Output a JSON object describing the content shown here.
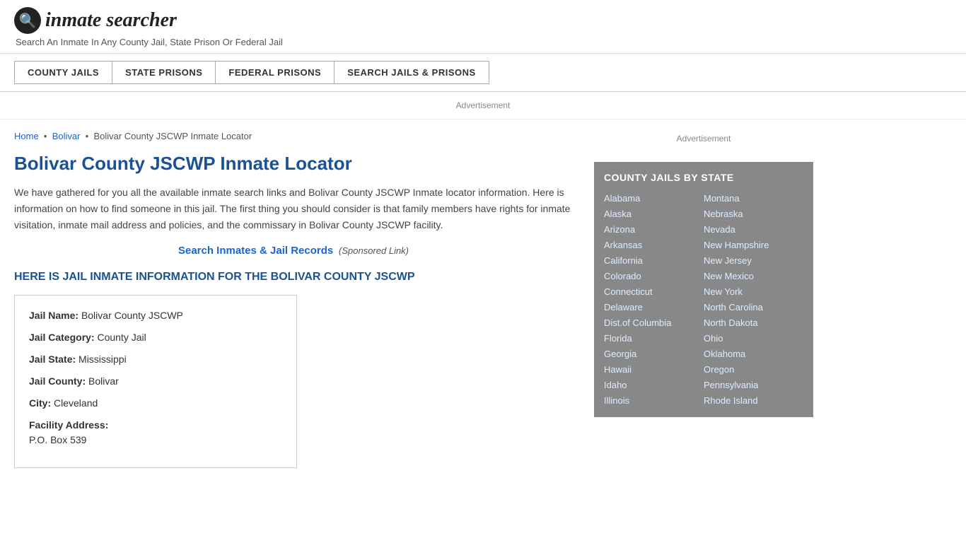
{
  "header": {
    "logo_icon": "🔍",
    "logo_text_prefix": "inmate",
    "logo_text_suffix": "searcher",
    "tagline": "Search An Inmate In Any County Jail, State Prison Or Federal Jail"
  },
  "nav": {
    "buttons": [
      {
        "label": "COUNTY JAILS",
        "name": "nav-county-jails"
      },
      {
        "label": "STATE PRISONS",
        "name": "nav-state-prisons"
      },
      {
        "label": "FEDERAL PRISONS",
        "name": "nav-federal-prisons"
      },
      {
        "label": "SEARCH JAILS & PRISONS",
        "name": "nav-search-jails"
      }
    ]
  },
  "ad_bar": "Advertisement",
  "breadcrumb": {
    "home": "Home",
    "parent": "Bolivar",
    "current": "Bolivar County JSCWP Inmate Locator"
  },
  "page_title": "Bolivar County JSCWP Inmate Locator",
  "description": "We have gathered for you all the available inmate search links and Bolivar County JSCWP Inmate locator information. Here is information on how to find someone in this jail. The first thing you should consider is that family members have rights for inmate visitation, inmate mail address and policies, and the commissary in Bolivar County JSCWP facility.",
  "search_link": {
    "text": "Search Inmates & Jail Records",
    "sponsored": "(Sponsored Link)"
  },
  "jail_info_heading": "HERE IS JAIL INMATE INFORMATION FOR THE BOLIVAR COUNTY JSCWP",
  "jail_details": {
    "name_label": "Jail Name:",
    "name_value": "Bolivar County JSCWP",
    "category_label": "Jail Category:",
    "category_value": "County Jail",
    "state_label": "Jail State:",
    "state_value": "Mississippi",
    "county_label": "Jail County:",
    "county_value": "Bolivar",
    "city_label": "City:",
    "city_value": "Cleveland",
    "address_label": "Facility Address:",
    "address_value": "P.O. Box 539"
  },
  "sidebar": {
    "ad_label": "Advertisement",
    "state_box_title": "COUNTY JAILS BY STATE",
    "states_col1": [
      "Alabama",
      "Alaska",
      "Arizona",
      "Arkansas",
      "California",
      "Colorado",
      "Connecticut",
      "Delaware",
      "Dist.of Columbia",
      "Florida",
      "Georgia",
      "Hawaii",
      "Idaho",
      "Illinois"
    ],
    "states_col2": [
      "Montana",
      "Nebraska",
      "Nevada",
      "New Hampshire",
      "New Jersey",
      "New Mexico",
      "New York",
      "North Carolina",
      "North Dakota",
      "Ohio",
      "Oklahoma",
      "Oregon",
      "Pennsylvania",
      "Rhode Island"
    ]
  }
}
